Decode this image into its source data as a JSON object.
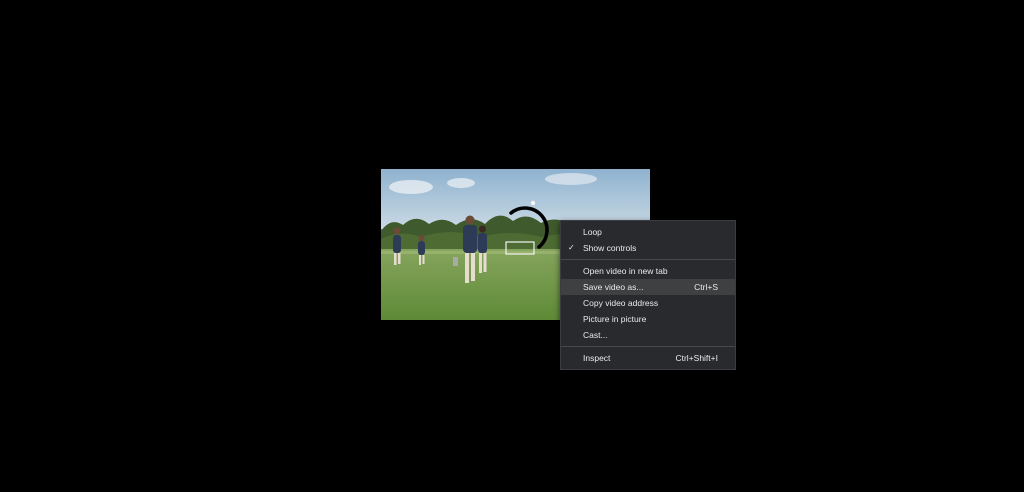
{
  "video": {
    "watermark": "",
    "icons": [
      "loading-spinner-icon"
    ]
  },
  "context_menu": {
    "items": [
      {
        "label": "Loop",
        "shortcut": "",
        "checked": false
      },
      {
        "label": "Show controls",
        "shortcut": "",
        "checked": true,
        "check_glyph": "✓"
      },
      {
        "label": "Open video in new tab",
        "shortcut": ""
      },
      {
        "label": "Save video as...",
        "shortcut": "Ctrl+S",
        "highlighted": true
      },
      {
        "label": "Copy video address",
        "shortcut": ""
      },
      {
        "label": "Picture in picture",
        "shortcut": ""
      },
      {
        "label": "Cast...",
        "shortcut": ""
      },
      {
        "label": "Inspect",
        "shortcut": "Ctrl+Shift+I"
      }
    ]
  },
  "colors": {
    "background": "#000000",
    "menu_bg": "#292a2d",
    "menu_highlight": "#3f4042",
    "menu_text": "#e8eaed"
  }
}
